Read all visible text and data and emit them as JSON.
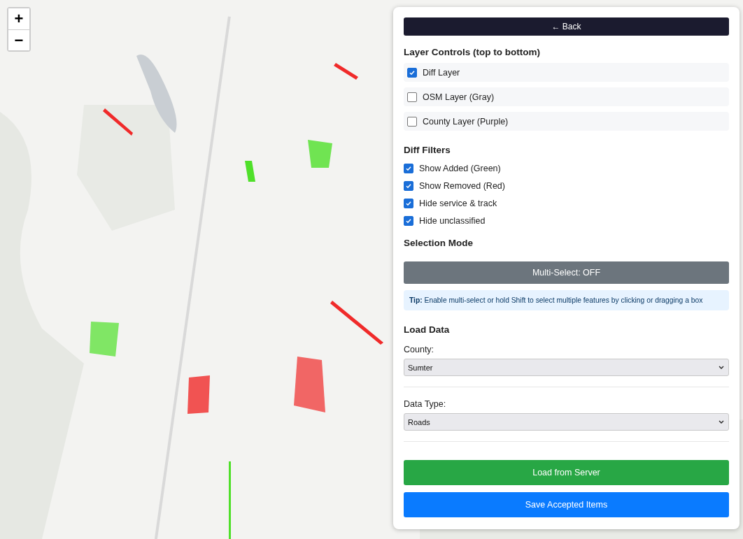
{
  "map": {
    "zoom_controls": [
      "+",
      "−"
    ]
  },
  "panel": {
    "back_button": "← Back",
    "layer_controls": {
      "title": "Layer Controls (top to bottom)",
      "items": [
        {
          "label": "Diff Layer",
          "checked": true
        },
        {
          "label": "OSM Layer (Gray)",
          "checked": false
        },
        {
          "label": "County Layer (Purple)",
          "checked": false
        }
      ]
    },
    "diff_filters": {
      "title": "Diff Filters",
      "items": [
        {
          "label": "Show Added (Green)",
          "checked": true
        },
        {
          "label": "Show Removed (Red)",
          "checked": true
        },
        {
          "label": "Hide service & track",
          "checked": true
        },
        {
          "label": "Hide unclassified",
          "checked": true
        }
      ]
    },
    "selection_mode": {
      "title": "Selection Mode",
      "button": {
        "label": "Multi-Select: OFF",
        "on": false
      },
      "tip": "**Tip:** Enable multi-select or hold Shift to select multiple features by clicking or dragging a box"
    },
    "load_data": {
      "title": "Load Data",
      "county": {
        "label": "County:",
        "value": "Sumter"
      },
      "data_type": {
        "label": "Data Type:",
        "value": "Roads"
      },
      "load_button": "Load from Server",
      "save_button": "Save Accepted Items"
    }
  }
}
